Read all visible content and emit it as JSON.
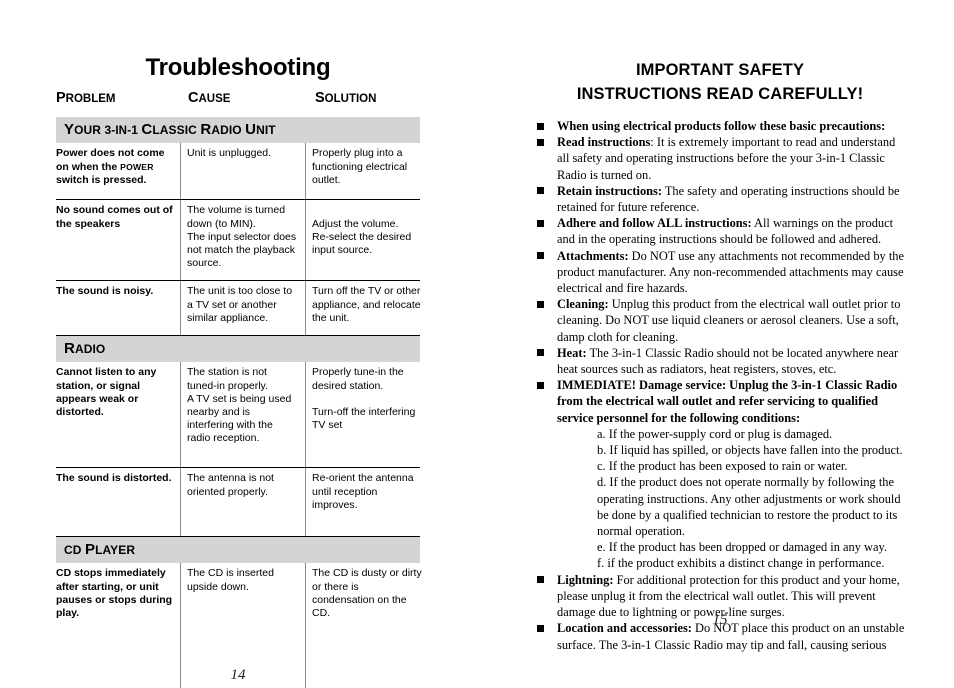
{
  "left_page": {
    "title": "Troubleshooting",
    "page_number": "14",
    "columns": [
      {
        "initial": "P",
        "rest": "ROBLEM"
      },
      {
        "initial": "C",
        "rest": "AUSE"
      },
      {
        "initial": "S",
        "rest": "OLUTION"
      }
    ],
    "sections": [
      {
        "heading_html": "<span class=\"cap\">Y</span>OUR 3-<span class=\"sm\">IN</span>-1 <span class=\"cap\">C</span>LASSIC <span class=\"cap\">R</span>ADIO <span class=\"cap\">U</span>NIT",
        "heading_text": "YOUR 3-IN-1 CLASSIC RADIO UNIT",
        "rows": [
          {
            "problem_html": "Power does not come on when the <span class=\"smallcap\">POWER</span> switch is pressed.",
            "problem_text": "Power does not come on when the POWER switch is pressed.",
            "cause": "Unit is unplugged.",
            "solution": "Properly plug into a functioning electrical outlet."
          },
          {
            "problem_html": "No sound comes out of the speakers",
            "problem_text": "No sound comes out of the speakers",
            "cause": "The volume is turned down (to MIN).\nThe input selector does not match the playback source.",
            "solution": "Adjust the volume.\nRe-select the desired input source."
          },
          {
            "problem_html": "The sound is noisy.",
            "problem_text": "The sound is noisy.",
            "cause": "The unit is too close to a TV set or another similar appliance.",
            "solution": "Turn off the TV or other appliance, and relocate the unit."
          }
        ]
      },
      {
        "heading_html": "<span class=\"cap\">R</span>ADIO",
        "heading_text": "RADIO",
        "rows": [
          {
            "problem_html": "Cannot listen to any station, or signal appears weak or distorted.",
            "problem_text": "Cannot listen to any station, or signal appears weak or distorted.",
            "cause": "The station is not tuned-in properly.\nA TV set is being used nearby and is interfering with the radio reception.",
            "solution": "Properly tune-in the desired station.\n\nTurn-off the interfering TV  set"
          },
          {
            "problem_html": "The sound is distorted.",
            "problem_text": "The sound is distorted.",
            "cause": "The antenna is not oriented properly.",
            "solution": " Re-orient the antenna until reception  improves."
          }
        ]
      },
      {
        "heading_html": "CD <span class=\"cap\">P</span>LAYER",
        "heading_text": "CD PLAYER",
        "rows": [
          {
            "problem_html": "CD stops immediately after starting, or unit pauses or stops during play.",
            "problem_text": "CD stops immediately after starting, or unit pauses or stops during play.",
            "cause": "The CD is inserted upside down.",
            "solution": "The CD is dusty or dirty or there is condensation on the CD."
          }
        ]
      }
    ]
  },
  "right_page": {
    "title_line1": "IMPORTANT SAFETY",
    "title_line2": "INSTRUCTIONS READ CAREFULLY!",
    "page_number": "15",
    "items": [
      {
        "lead": "When using electrical products follow these basic precautions:",
        "body": "",
        "all_bold": true
      },
      {
        "lead": "Read instructions",
        "body": ": It is extremely important to read and understand all safety and operating instructions before the your 3-in-1 Classic Radio is turned on."
      },
      {
        "lead": "Retain instructions:",
        "body": " The safety and operating instructions should be retained for future reference."
      },
      {
        "lead": "Adhere and follow ALL instructions:",
        "body": " All warnings on the product and in the operating instructions should be followed and adhered."
      },
      {
        "lead": "Attachments:",
        "body": " Do NOT use any attachments not recommended by the product manufacturer. Any non-recommended attachments may cause electrical and fire hazards."
      },
      {
        "lead": "Cleaning:",
        "body": " Unplug this product from the electrical wall outlet prior to cleaning. Do NOT use liquid cleaners or aerosol cleaners. Use a soft, damp cloth for cleaning."
      },
      {
        "lead": "Heat:",
        "body": " The 3-in-1 Classic Radio should not be located anywhere near heat sources such as radiators, heat registers, stoves, etc."
      },
      {
        "lead": "IMMEDIATE! Damage service: Unplug the 3-in-1 Classic Radio from the electrical wall outlet and refer servicing to qualified service personnel for the following conditions:",
        "body": "",
        "all_bold": true
      }
    ],
    "sub_items": [
      "a. If the power-supply cord or plug is damaged.",
      "b. If liquid has spilled, or objects have fallen into the product.",
      "c. If the product has been exposed to rain or water.",
      "d. If the product does not operate normally by following the operating instructions. Any other adjustments or work should be done by a qualified technician to restore the product to its normal operation.",
      "e. If the product has been dropped or damaged in any way.",
      "f. if the product exhibits a distinct change in performance."
    ],
    "items_tail": [
      {
        "lead": "Lightning:",
        "body": " For additional protection for this product and your home, please unplug it from the electrical wall outlet. This will prevent damage due to lightning or power-line surges."
      },
      {
        "lead": "Location and accessories:",
        "body": " Do NOT place this product on an unstable surface. The 3-in-1 Classic Radio may tip and fall, causing serious"
      }
    ]
  },
  "colors": {
    "section_bar_bg": "#d4d4d4",
    "rule": "#000000",
    "vrule": "#8c8c8c",
    "text": "#000000"
  }
}
